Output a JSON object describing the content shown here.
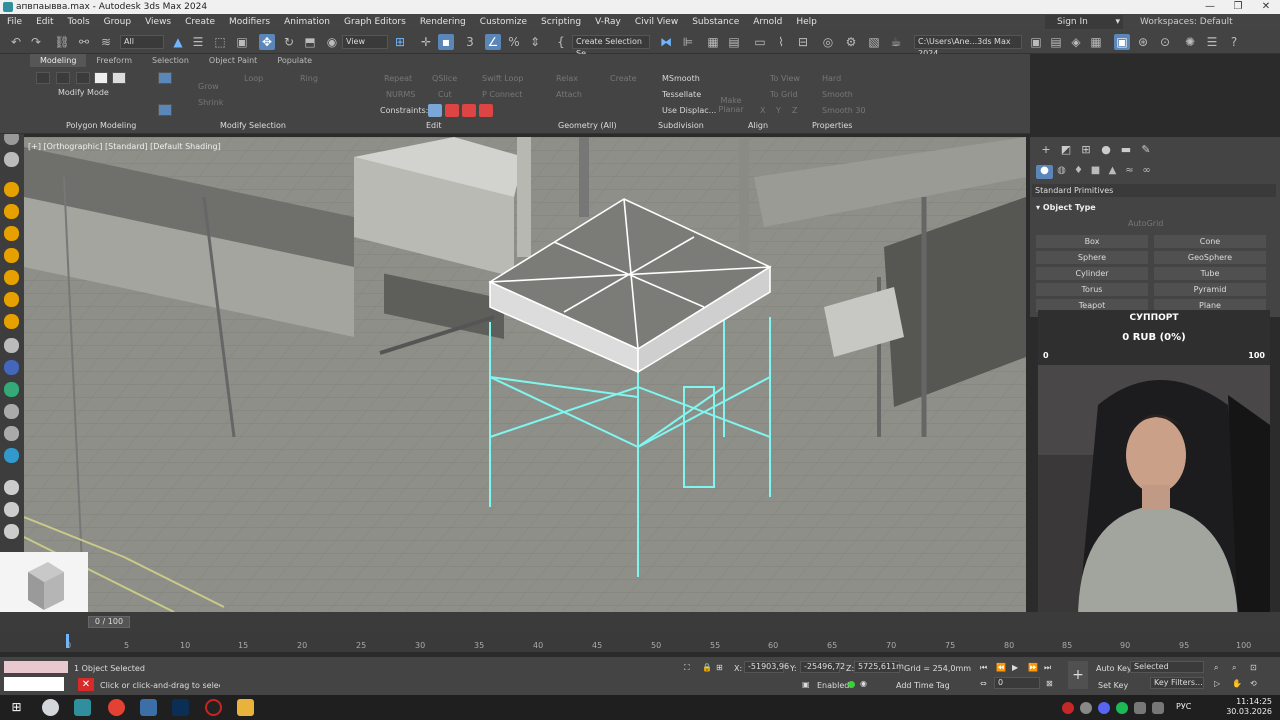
{
  "window": {
    "title": "апвпаывва.max - Autodesk 3ds Max 2024"
  },
  "menu": {
    "items": [
      "File",
      "Edit",
      "Tools",
      "Group",
      "Views",
      "Create",
      "Modifiers",
      "Animation",
      "Graph Editors",
      "Rendering",
      "Customize",
      "Scripting",
      "V-Ray",
      "Civil View",
      "Substance",
      "Arnold",
      "Help"
    ],
    "sign_in": "Sign In",
    "workspaces_label": "Workspaces:",
    "workspace_value": "Default"
  },
  "toolbar": {
    "filter": "All",
    "view": "View",
    "selection_set": "Create Selection Se",
    "path": "C:\\Users\\Ane...3ds Max 2024"
  },
  "ribbon": {
    "tabs": [
      "Modeling",
      "Freeform",
      "Selection",
      "Object Paint",
      "Populate"
    ],
    "modify_mode": "Modify Mode",
    "grow": "Grow",
    "shrink": "Shrink",
    "loop": "Loop",
    "ring": "Ring",
    "repeat": "Repeat",
    "qslice": "QSlice",
    "swift_loop": "Swift Loop",
    "nurms": "NURMS",
    "cut": "Cut",
    "p_connect": "P Connect",
    "constraints": "Constraints:",
    "relax": "Relax",
    "create": "Create",
    "attach": "Attach",
    "msmooth": "MSmooth",
    "tessellate": "Tessellate",
    "use_displace": "Use Displac...",
    "make_planar": "Make Planar",
    "to_view": "To View",
    "to_grid": "To Grid",
    "x": "X",
    "y": "Y",
    "z": "Z",
    "hard": "Hard",
    "smooth": "Smooth",
    "smooth30": "Smooth 30",
    "groups": [
      "Polygon Modeling",
      "Modify Selection",
      "Edit",
      "Geometry (All)",
      "Subdivision",
      "Align",
      "Properties"
    ]
  },
  "viewport": {
    "label": "[+] [Orthographic] [Standard] [Default Shading]"
  },
  "command_panel": {
    "primitive_type": "Standard Primitives",
    "object_type": "Object Type",
    "autogrid": "AutoGrid",
    "buttons": [
      "Box",
      "Cone",
      "Sphere",
      "GeoSphere",
      "Cylinder",
      "Tube",
      "Torus",
      "Pyramid",
      "Teapot",
      "Plane"
    ]
  },
  "donation": {
    "title": "СУППОРТ",
    "amount": "0 RUB (0%)",
    "min": "0",
    "max": "100",
    "progress": 0
  },
  "timeline": {
    "frame_range": "0 / 100",
    "ticks": [
      "0",
      "5",
      "10",
      "15",
      "20",
      "25",
      "30",
      "35",
      "40",
      "45",
      "50",
      "55",
      "60",
      "65",
      "70",
      "75",
      "80",
      "85",
      "90",
      "95",
      "100"
    ]
  },
  "status": {
    "selection": "1 Object Selected",
    "prompt": "Click or click-and-drag to select and move objects",
    "x_label": "X:",
    "x_value": "-51903,96",
    "y_label": "Y:",
    "y_value": "-25496,72",
    "z_label": "Z:",
    "z_value": "5725,611m",
    "grid": "Grid = 254,0mm",
    "enabled": "Enabled:",
    "add_time_tag": "Add Time Tag",
    "auto_key": "Auto Key",
    "selected": "Selected",
    "set_key": "Set Key",
    "key_filters": "Key Filters...",
    "frame": "0"
  },
  "taskbar": {
    "lang": "РУС",
    "time": "11:14:25",
    "date": "30.03.2026"
  }
}
